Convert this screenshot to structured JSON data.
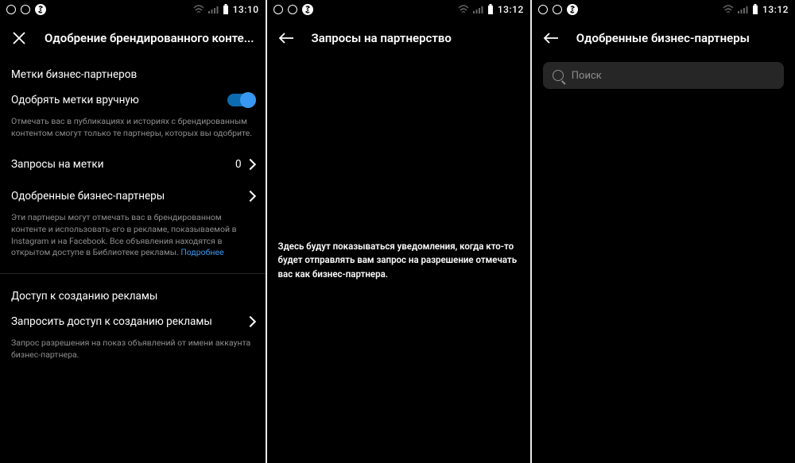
{
  "status": {
    "time1": "13:10",
    "time2": "13:12",
    "time3": "13:12"
  },
  "screen1": {
    "title": "Одобрение брендированного конте...",
    "section1": "Метки бизнес-партнеров",
    "toggle_label": "Одобрять метки вручную",
    "toggle_desc": "Отмечать вас в публикациях и историях с брендированным контентом смогут только те партнеры, которых вы одобрите.",
    "requests_label": "Запросы на метки",
    "requests_count": "0",
    "approved_label": "Одобренные бизнес-партнеры",
    "approved_desc": "Эти партнеры могут отмечать вас в брендированном контенте и использовать его в рекламе, показываемой в Instagram и на Facebook. Все объявления находятся в открытом доступе в Библиотеке рекламы. ",
    "approved_link": "Подробнее",
    "section2": "Доступ к созданию рекламы",
    "request_access_label": "Запросить доступ к созданию рекламы",
    "request_access_desc": "Запрос разрешения на показ объявлений от имени аккаунта бизнес-партнера."
  },
  "screen2": {
    "title": "Запросы на партнерство",
    "empty": "Здесь будут показываться уведомления, когда кто-то будет отправлять вам запрос на разрешение отмечать вас как бизнес-партнера."
  },
  "screen3": {
    "title": "Одобренные бизнес-партнеры",
    "search_placeholder": "Поиск"
  }
}
